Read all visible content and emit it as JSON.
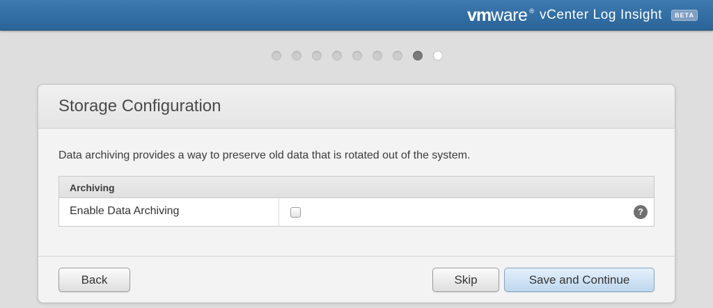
{
  "header": {
    "brand_vm": "vm",
    "brand_ware": "ware",
    "brand_reg": "®",
    "product": "vCenter Log Insight",
    "badge": "BETA"
  },
  "wizard": {
    "total_steps": 9,
    "current_step": 8
  },
  "card": {
    "title": "Storage Configuration",
    "description": "Data archiving provides a way to preserve old data that is rotated out of the system.",
    "section_title": "Archiving",
    "rows": [
      {
        "label": "Enable Data Archiving",
        "checked": false,
        "help_icon": "?"
      }
    ]
  },
  "footer": {
    "back_label": "Back",
    "skip_label": "Skip",
    "save_label": "Save and Continue"
  },
  "colors": {
    "header_blue": "#2f6ca3",
    "primary_button": "#cfe2f5",
    "active_dot": "#7a7a7a"
  }
}
